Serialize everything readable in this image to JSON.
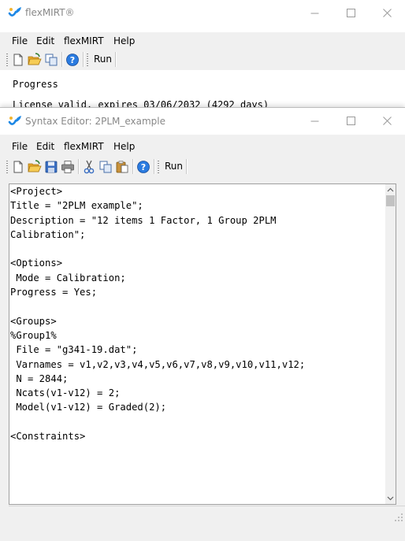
{
  "main_window": {
    "title": "flexMIRT®",
    "menu": [
      "File",
      "Edit",
      "flexMIRT",
      "Help"
    ],
    "toolbar": {
      "icons": [
        "new-document-icon",
        "open-folder-icon",
        "copy-icon",
        "help-icon"
      ],
      "run_label": "Run"
    },
    "progress_lines": [
      "Progress",
      "License valid, expires 03/06/2032 (4292 days)"
    ]
  },
  "editor_window": {
    "title": "Syntax Editor: 2PLM_example",
    "menu": [
      "File",
      "Edit",
      "flexMIRT",
      "Help"
    ],
    "toolbar": {
      "icons": [
        "new-document-icon",
        "open-folder-icon",
        "save-icon",
        "print-icon",
        "cut-icon",
        "copy-icon",
        "paste-icon",
        "help-icon"
      ],
      "run_label": "Run"
    },
    "code_lines": [
      "<Project>",
      "Title = \"2PLM example\";",
      "Description = \"12 items 1 Factor, 1 Group 2PLM",
      "Calibration\";",
      "",
      "<Options>",
      " Mode = Calibration;",
      "Progress = Yes;",
      "",
      "<Groups>",
      "%Group1%",
      " File = \"g341-19.dat\";",
      " Varnames = v1,v2,v3,v4,v5,v6,v7,v8,v9,v10,v11,v12;",
      " N = 2844;",
      " Ncats(v1-v12) = 2;",
      " Model(v1-v12) = Graded(2);",
      "",
      "<Constraints>"
    ]
  },
  "colors": {
    "icon_blue": "#1e88e5",
    "icon_yellow": "#f2b531",
    "title_text": "#888888",
    "chrome_bg": "#f0f0f0"
  }
}
